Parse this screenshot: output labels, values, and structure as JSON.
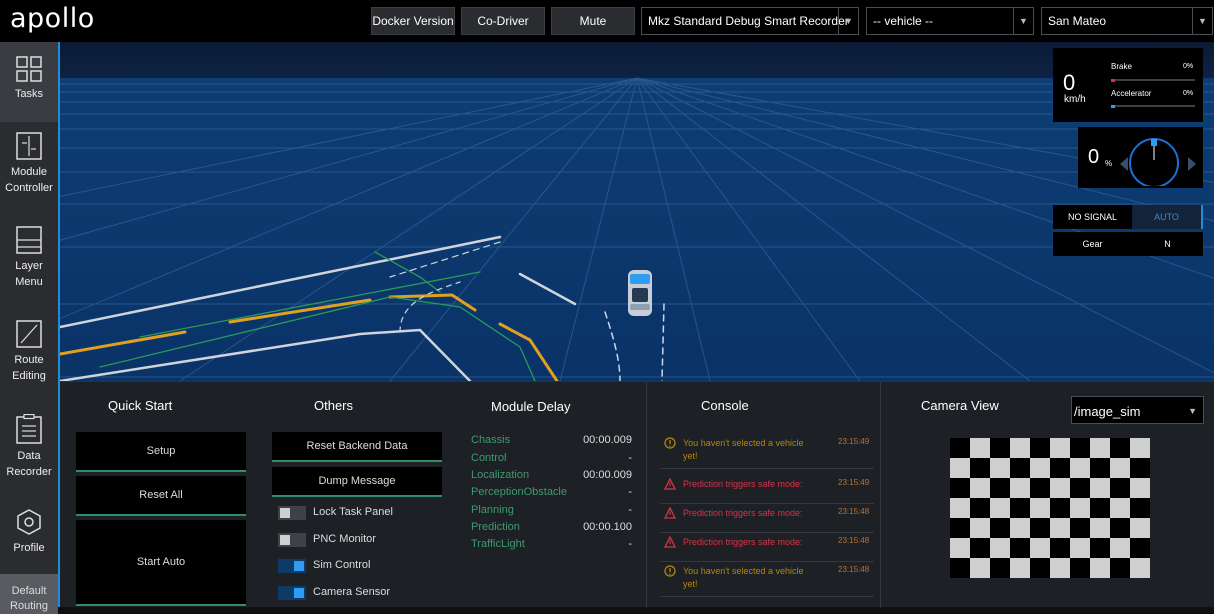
{
  "header": {
    "logo": "apollo",
    "buttons": {
      "docker": "Docker Version",
      "codriver": "Co-Driver",
      "mute": "Mute"
    },
    "selects": {
      "mode": "Mkz Standard Debug Smart Recorder",
      "vehicle": "-- vehicle --",
      "map": "San Mateo"
    }
  },
  "sidebar": {
    "items": [
      {
        "label": "Tasks"
      },
      {
        "label_1": "Module",
        "label_2": "Controller"
      },
      {
        "label_1": "Layer",
        "label_2": "Menu"
      },
      {
        "label_1": "Route",
        "label_2": "Editing"
      },
      {
        "label_1": "Data",
        "label_2": "Recorder"
      },
      {
        "label": "Profile"
      }
    ],
    "default_1": "Default",
    "default_2": "Routing"
  },
  "dashboard": {
    "speed": "0",
    "speed_unit": "km/h",
    "brake_label": "Brake",
    "brake_value": "0%",
    "accel_label": "Accelerator",
    "accel_value": "0%",
    "steering_value": "0",
    "steering_unit": "%",
    "signal": "NO SIGNAL",
    "mode": "AUTO",
    "gear_label": "Gear",
    "gear_value": "N",
    "colors": {
      "accent": "#1e8cd8",
      "brake": "#d9334a",
      "accel": "#2e9cf0"
    }
  },
  "quick_start": {
    "title": "Quick Start",
    "setup": "Setup",
    "reset_all": "Reset All",
    "start_auto": "Start Auto"
  },
  "others": {
    "title": "Others",
    "reset_backend": "Reset Backend Data",
    "dump_message": "Dump Message",
    "toggles": [
      {
        "label": "Lock Task Panel",
        "on": false
      },
      {
        "label": "PNC Monitor",
        "on": false
      },
      {
        "label": "Sim Control",
        "on": true
      },
      {
        "label": "Camera Sensor",
        "on": true
      }
    ]
  },
  "module_delay": {
    "title": "Module Delay",
    "rows": [
      {
        "name": "Chassis",
        "value": "00:00.009"
      },
      {
        "name": "Control",
        "value": "-"
      },
      {
        "name": "Localization",
        "value": "00:00.009"
      },
      {
        "name": "PerceptionObstacle",
        "value": "-"
      },
      {
        "name": "Planning",
        "value": "-"
      },
      {
        "name": "Prediction",
        "value": "00:00.100"
      },
      {
        "name": "TrafficLight",
        "value": "-"
      }
    ]
  },
  "console": {
    "title": "Console",
    "messages": [
      {
        "level": "warning",
        "text": "You haven't selected a vehicle yet!",
        "time": "23:15:49"
      },
      {
        "level": "error",
        "text": "Prediction triggers safe mode:",
        "time": "23:15:49"
      },
      {
        "level": "error",
        "text": "Prediction triggers safe mode:",
        "time": "23:15:48"
      },
      {
        "level": "error",
        "text": "Prediction triggers safe mode:",
        "time": "23:15:48"
      },
      {
        "level": "warning",
        "text": "You haven't selected a vehicle yet!",
        "time": "23:15:48"
      }
    ]
  },
  "camera": {
    "title": "Camera View",
    "channel": "/image_sim"
  }
}
